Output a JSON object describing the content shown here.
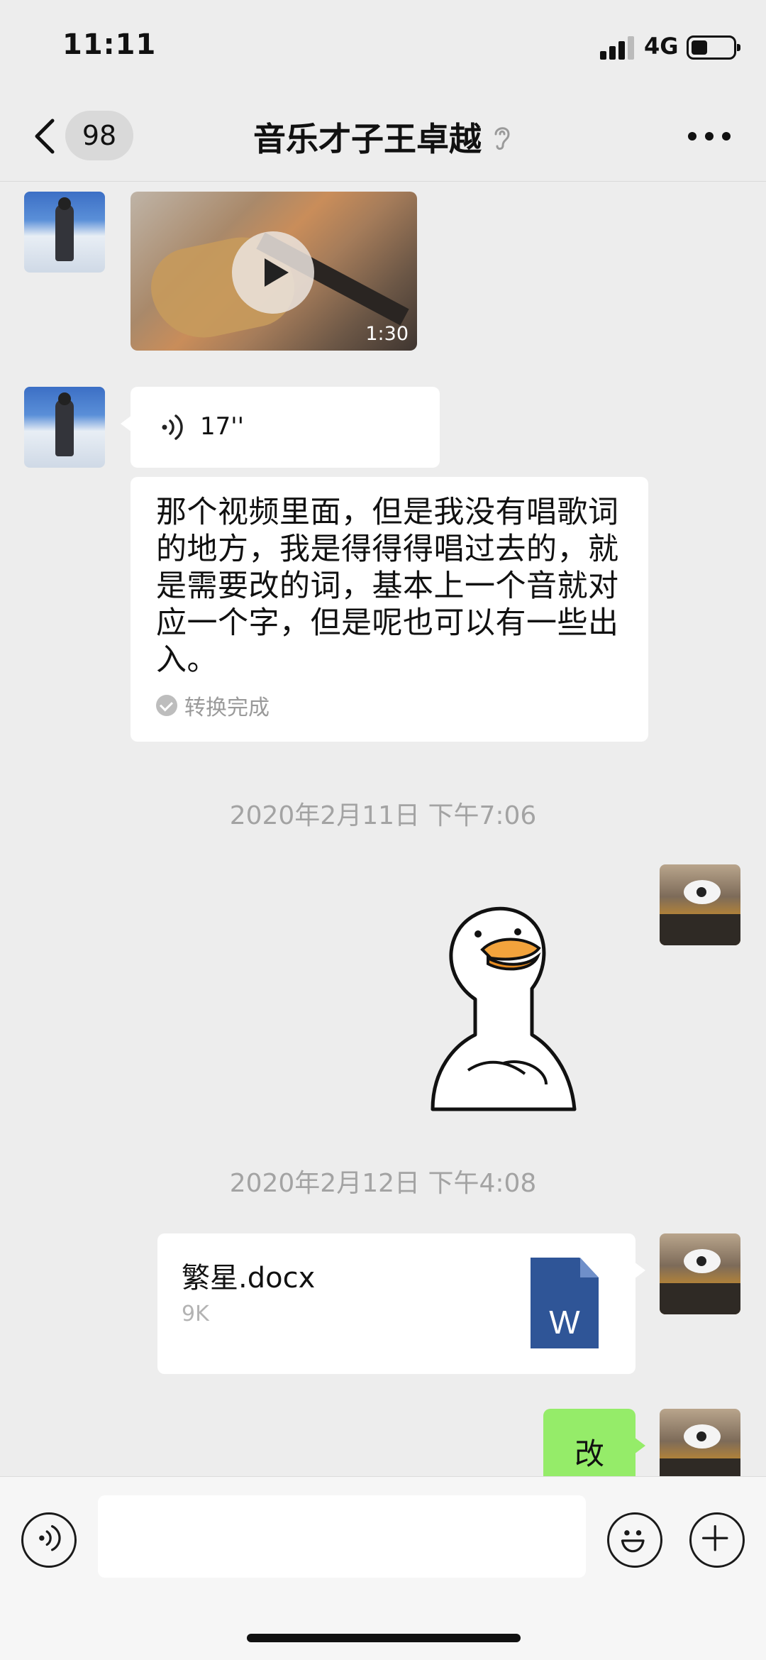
{
  "status_bar": {
    "time": "11:11",
    "network": "4G"
  },
  "nav": {
    "unread_count": "98",
    "title": "音乐才子王卓越"
  },
  "messages": {
    "video": {
      "duration": "1:30"
    },
    "voice": {
      "duration": "17''"
    },
    "transcript": {
      "text": "那个视频里面，但是我没有唱歌词的地方，我是得得得唱过去的，就是需要改的词，基本上一个音就对应一个字，但是呢也可以有一些出入。",
      "status": "转换完成"
    },
    "timestamp_1": "2020年2月11日 下午7:06",
    "timestamp_2": "2020年2月12日 下午4:08",
    "file": {
      "name": "繁星.docx",
      "size": "9K",
      "icon_letter": "W",
      "icon_color": "#2f5597"
    },
    "text_reply": "改"
  },
  "input_bar": {
    "placeholder": ""
  },
  "colors": {
    "background": "#ededed",
    "self_bubble": "#95ec69",
    "peer_bubble": "#ffffff"
  }
}
